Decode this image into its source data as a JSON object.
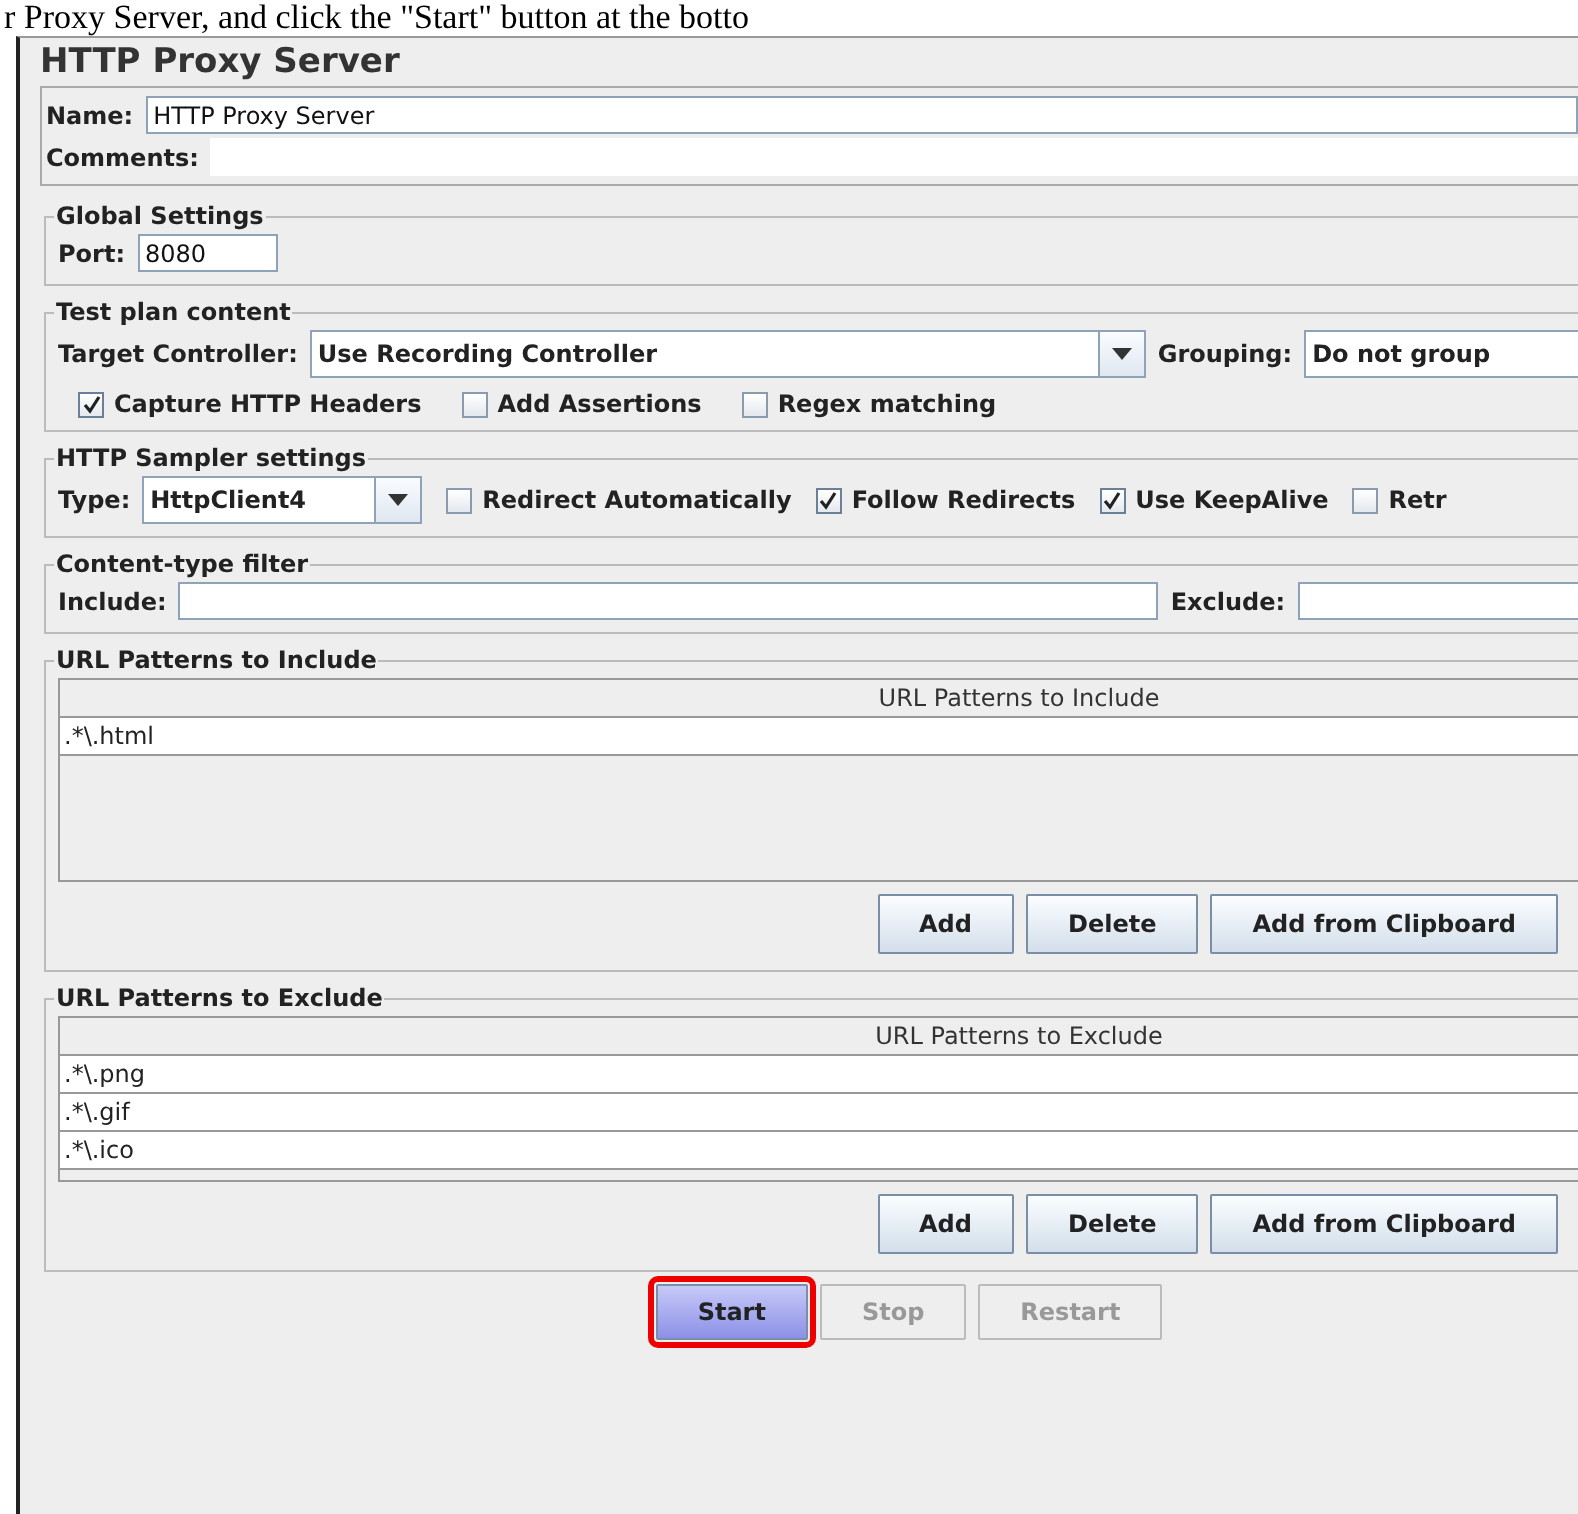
{
  "caption": "r Proxy Server, and click the \"Start\" button at the botto",
  "title": "HTTP Proxy Server",
  "name": {
    "label": "Name:",
    "value": "HTTP Proxy Server"
  },
  "comments": {
    "label": "Comments:"
  },
  "global_settings": {
    "title": "Global Settings",
    "port_label": "Port:",
    "port_value": "8080"
  },
  "test_plan_content": {
    "title": "Test plan content",
    "target_controller_label": "Target Controller:",
    "target_controller_value": "Use Recording Controller",
    "grouping_label": "Grouping:",
    "grouping_value": "Do not group",
    "checkboxes": [
      {
        "label": "Capture HTTP Headers",
        "checked": true
      },
      {
        "label": "Add Assertions",
        "checked": false
      },
      {
        "label": "Regex matching",
        "checked": false
      }
    ]
  },
  "http_sampler_settings": {
    "title": "HTTP Sampler settings",
    "type_label": "Type:",
    "type_value": "HttpClient4",
    "checkboxes": [
      {
        "label": "Redirect Automatically",
        "checked": false
      },
      {
        "label": "Follow Redirects",
        "checked": true
      },
      {
        "label": "Use KeepAlive",
        "checked": true
      },
      {
        "label": "Retr",
        "checked": false
      }
    ]
  },
  "content_type_filter": {
    "title": "Content-type filter",
    "include_label": "Include:",
    "exclude_label": "Exclude:"
  },
  "url_patterns_include": {
    "title": "URL Patterns to Include",
    "column": "URL Patterns to Include",
    "rows": [
      ".*\\.html"
    ],
    "buttons": [
      "Add",
      "Delete",
      "Add from Clipboard"
    ]
  },
  "url_patterns_exclude": {
    "title": "URL Patterns to Exclude",
    "column": "URL Patterns to Exclude",
    "rows": [
      ".*\\.png",
      ".*\\.gif",
      ".*\\.ico"
    ],
    "buttons": [
      "Add",
      "Delete",
      "Add from Clipboard"
    ]
  },
  "actions": [
    {
      "label": "Start",
      "disabled": false,
      "highlighted": true
    },
    {
      "label": "Stop",
      "disabled": true,
      "highlighted": false
    },
    {
      "label": "Restart",
      "disabled": true,
      "highlighted": false
    }
  ]
}
